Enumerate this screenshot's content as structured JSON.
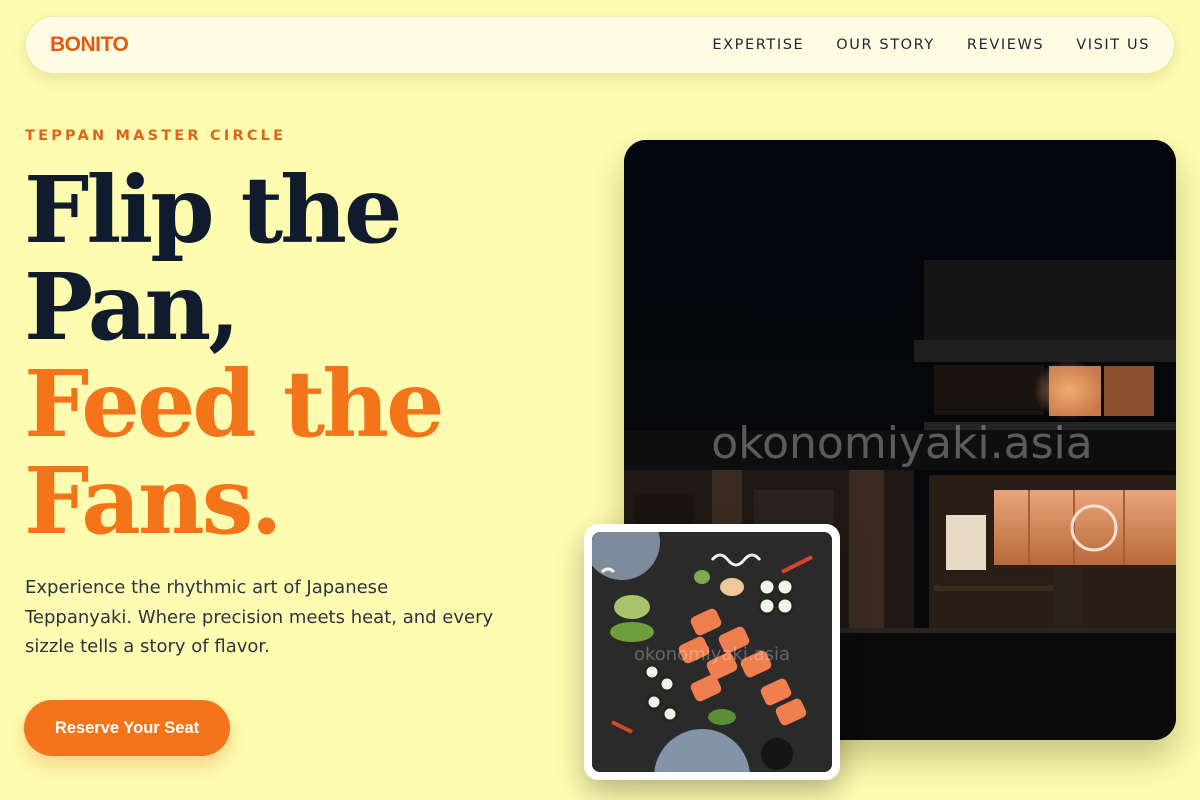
{
  "nav": {
    "brand": "BONITO",
    "links": [
      "EXPERTISE",
      "OUR STORY",
      "REVIEWS",
      "VISIT US"
    ]
  },
  "hero": {
    "eyebrow": "TEPPAN MASTER CIRCLE",
    "headline": {
      "line1": "Flip the",
      "line2": "Pan,",
      "line3": "Feed the",
      "line4": "Fans."
    },
    "description": "Experience the rhythmic art of Japanese Teppanyaki. Where precision meets heat, and every sizzle tells a story of flavor.",
    "cta_label": "Reserve Your Seat"
  },
  "images": {
    "main_watermark": "okonomiyaki.asia",
    "small_watermark": "okonomiyaki.asia"
  },
  "colors": {
    "background": "#fefcb0",
    "accent": "#f47519",
    "brand": "#e25a12",
    "heading_dark": "#111b2e"
  }
}
